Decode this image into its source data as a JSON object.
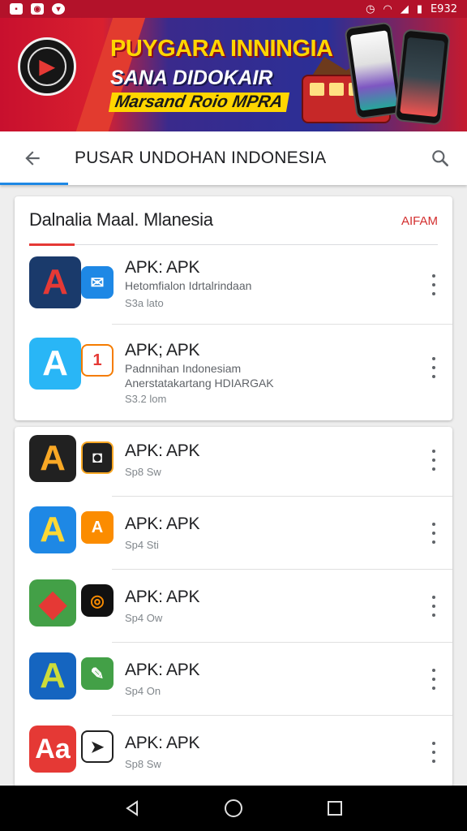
{
  "status_bar": {
    "time": "E932"
  },
  "banner": {
    "line1": "PUYGARA INNINGIA",
    "line2": "SANA DIDOKAIR",
    "line3": "Marsand Roio MPRA",
    "logo_icon": "flag-logo-icon"
  },
  "appbar": {
    "back_icon": "arrow-back-icon",
    "title": "PUSAR UNDOHAN INDONESIA",
    "search_icon": "search-icon"
  },
  "card1": {
    "title": "Dalnalia Maal. Mlanesia",
    "more_label": "AIFAM",
    "items": [
      {
        "name": "APK: APK",
        "sub": "Hetomfialon Idrtalrindaan",
        "size": "S3a lato"
      },
      {
        "name": "APK; APK",
        "sub": "Padnnihan Indonesiam",
        "sub2": "Anerstatakartang HDIARGAK",
        "size": "S3.2 lom"
      }
    ]
  },
  "card2": {
    "items": [
      {
        "name": "APK: APK",
        "size": "Sp8 Sw"
      },
      {
        "name": "APK: APK",
        "size": "Sp4 Sti"
      },
      {
        "name": "APK: APK",
        "size": "Sp4 Ow"
      },
      {
        "name": "APK: APK",
        "size": "Sp4 On"
      },
      {
        "name": "APK: APK",
        "size": "Sp8 Sw"
      }
    ]
  },
  "colors": {
    "accent": "#1e88e5",
    "brand_red": "#d32f2f"
  },
  "navbar": {
    "back_icon": "nav-back-icon",
    "home_icon": "nav-home-icon",
    "recents_icon": "nav-recents-icon"
  }
}
